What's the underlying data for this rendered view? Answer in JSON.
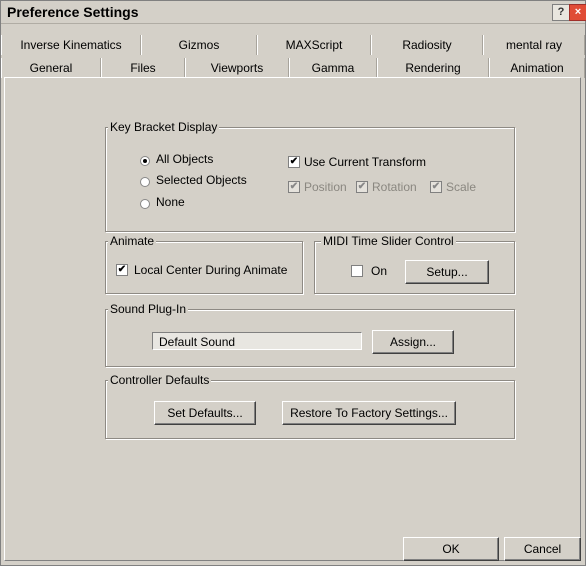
{
  "window": {
    "title": "Preference Settings",
    "help_glyph": "?",
    "close_glyph": "×"
  },
  "tabs": {
    "row1": [
      "Inverse Kinematics",
      "Gizmos",
      "MAXScript",
      "Radiosity",
      "mental ray"
    ],
    "row2": [
      "General",
      "Files",
      "Viewports",
      "Gamma",
      "Rendering",
      "Animation"
    ],
    "active": "Animation"
  },
  "key_bracket": {
    "legend": "Key Bracket Display",
    "radios": [
      "All Objects",
      "Selected Objects",
      "None"
    ],
    "selected": "All Objects",
    "use_current_transform": "Use Current Transform",
    "sub_checks": [
      "Position",
      "Rotation",
      "Scale"
    ]
  },
  "animate": {
    "legend": "Animate",
    "checkbox": "Local Center During Animate"
  },
  "midi": {
    "legend": "MIDI Time Slider Control",
    "on_label": "On",
    "setup_button": "Setup..."
  },
  "sound": {
    "legend": "Sound Plug-In",
    "field_value": "Default Sound",
    "assign_button": "Assign..."
  },
  "controller": {
    "legend": "Controller Defaults",
    "set_defaults": "Set Defaults...",
    "restore": "Restore To Factory Settings..."
  },
  "footer": {
    "ok": "OK",
    "cancel": "Cancel"
  },
  "check_glyph": "✔"
}
